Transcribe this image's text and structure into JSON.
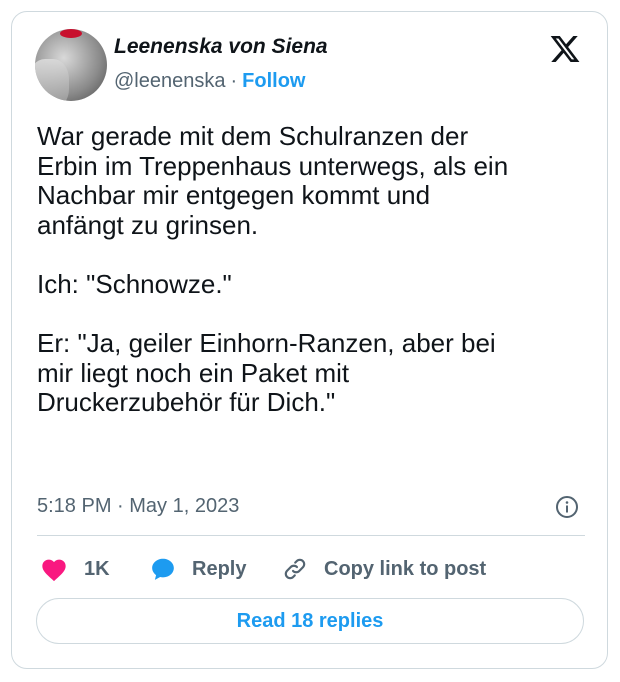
{
  "author": {
    "display_name": "Leenenska von Siena",
    "handle": "@leenenska",
    "separator": "·",
    "follow_label": "Follow"
  },
  "tweet": {
    "text": "War gerade mit dem Schulranzen der\nErbin im Treppenhaus unterwegs, als ein\nNachbar mir entgegen kommt und\nanfängt zu grinsen.\n\nIch: \"Schnowze.\"\n\nEr: \"Ja, geiler Einhorn-Ranzen, aber bei\nmir liegt noch ein Paket mit\nDruckerzubehör für Dich.\"",
    "timestamp": "5:18 PM · May 1, 2023"
  },
  "actions": {
    "like_count": "1K",
    "reply_label": "Reply",
    "copy_label": "Copy link to post"
  },
  "read_replies_label": "Read 18 replies",
  "colors": {
    "accent": "#1d9bf0",
    "like": "#f91880",
    "text": "#0f1419",
    "muted": "#536471",
    "border": "#cfd9de"
  },
  "icons": [
    "x-logo-icon",
    "info-icon",
    "heart-icon",
    "reply-bubble-icon",
    "link-icon"
  ]
}
